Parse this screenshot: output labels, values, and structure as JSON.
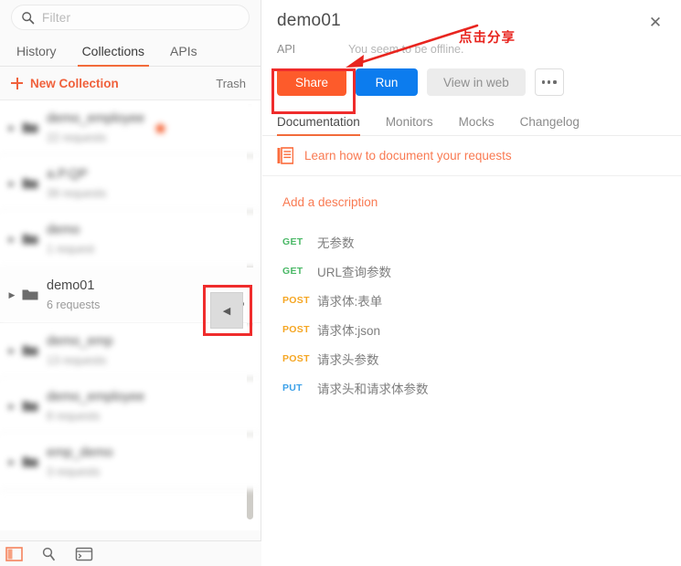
{
  "sidebar": {
    "search": {
      "placeholder": "Filter",
      "icon": "search-icon"
    },
    "tabs": [
      {
        "label": "History",
        "active": false
      },
      {
        "label": "Collections",
        "active": true
      },
      {
        "label": "APIs",
        "active": false
      }
    ],
    "new_collection_label": "New Collection",
    "trash_label": "Trash",
    "collections": [
      {
        "name": "demo_employee",
        "count": "22 requests",
        "starred": true,
        "blurred": true,
        "selected": false
      },
      {
        "name": "a.P.QP",
        "count": "39 requests",
        "starred": false,
        "blurred": true,
        "selected": false
      },
      {
        "name": "demo",
        "count": "1 request",
        "starred": false,
        "blurred": true,
        "selected": false
      },
      {
        "name": "demo01",
        "count": "6 requests",
        "starred": false,
        "blurred": false,
        "selected": true
      },
      {
        "name": "demo_emp",
        "count": "13 requests",
        "starred": false,
        "blurred": true,
        "selected": false
      },
      {
        "name": "demo_employee",
        "count": "8 requests",
        "starred": false,
        "blurred": true,
        "selected": false
      },
      {
        "name": "emp_demo",
        "count": "3 requests",
        "starred": false,
        "blurred": true,
        "selected": false
      }
    ],
    "collapse_glyph": "◀",
    "bottom_icons": [
      "sidebar-toggle-icon",
      "search-icon",
      "console-icon"
    ]
  },
  "right_panel": {
    "title": "demo01",
    "close_glyph": "✕",
    "type_label": "API",
    "status_text": "You seem to be offline.",
    "buttons": {
      "share": "Share",
      "run": "Run",
      "view_in_web": "View in web",
      "more": "more-options"
    },
    "tabs": [
      {
        "label": "Documentation",
        "active": true
      },
      {
        "label": "Monitors",
        "active": false
      },
      {
        "label": "Mocks",
        "active": false
      },
      {
        "label": "Changelog",
        "active": false
      }
    ],
    "learn_link": "Learn how to document your requests",
    "add_description": "Add a description",
    "requests": [
      {
        "method": "GET",
        "name": "无参数"
      },
      {
        "method": "GET",
        "name": "URL查询参数"
      },
      {
        "method": "POST",
        "name": "请求体:表单"
      },
      {
        "method": "POST",
        "name": "请求体:json"
      },
      {
        "method": "POST",
        "name": "请求头参数"
      },
      {
        "method": "PUT",
        "name": "请求头和请求体参数"
      }
    ]
  },
  "annotation": {
    "text": "点击分享",
    "color": "#e8251f"
  },
  "colors": {
    "accent_orange": "#f26b3a",
    "share_orange": "#fd5b2b",
    "run_blue": "#0c7cee",
    "annotation_red": "#ef2c2c",
    "get_green": "#4ab866",
    "post_amber": "#f5a623",
    "put_blue": "#3aa0e8"
  }
}
